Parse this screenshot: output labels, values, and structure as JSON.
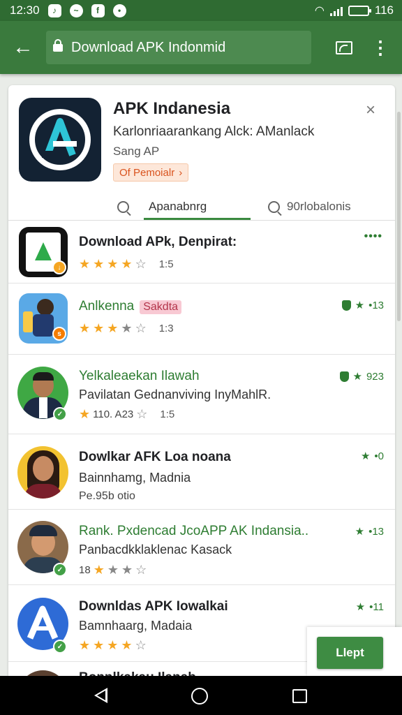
{
  "status_bar": {
    "time": "12:30",
    "battery": "116",
    "battery_level": 0.85,
    "notification_icons": [
      "tiktok-icon",
      "messenger-icon",
      "facebook-icon",
      "chat-icon"
    ]
  },
  "app_bar": {
    "url": "Download APK Indonmid"
  },
  "app_header": {
    "title": "APK Indanesia",
    "description": "Karlonriaarankang Alck: AManlack",
    "subtitle": "Sang AP",
    "chip_label": "Of Pemoialr",
    "close_symbol": "×"
  },
  "tabs": [
    {
      "label": "Apanabnrg",
      "active": true
    },
    {
      "label": "90rlobalonis",
      "active": false
    }
  ],
  "list": [
    {
      "title": "Download APk, Denpirat:",
      "rating": 4,
      "rating_text": "1:5",
      "right_text": "",
      "more": "••••"
    },
    {
      "title": "Anlkenna",
      "tag": "Sakdta",
      "rating": 3,
      "rating_text": "1:3",
      "right_text": "•13"
    },
    {
      "title": "Yelkaleaekan Ilawah",
      "subtitle": "Pavilatan Gednanviving InyMahlR.",
      "rating_text_pre": "110. A23",
      "rating_text": "1:5",
      "right_text": "923"
    },
    {
      "title": "Dowlkar AFK Loa noana",
      "subtitle": "Bainnhamg, Madnia",
      "meta": "Pe.95b otio",
      "right_text": "•0"
    },
    {
      "title": "Rank. Pxdencad JcoAPP AK Indansia..",
      "subtitle": "Panbacdkklaklenac Kasack",
      "rating_text_pre": "18",
      "rating": 1,
      "rating_text": "",
      "right_text": "•13"
    },
    {
      "title": "Downldas APK Iowalkai",
      "subtitle": "Bamnhaarg, Madaia",
      "rating": 4,
      "rating_text": "",
      "right_text": "•11"
    },
    {
      "title": "Bonnlkakau Ilanab"
    }
  ],
  "primary_button": "Llept",
  "colors": {
    "status_bar": "#2f6b32",
    "app_bar": "#3a7a3d",
    "accent_green": "#2e7d32",
    "star": "#f5a623",
    "chip_text": "#d9531e"
  }
}
